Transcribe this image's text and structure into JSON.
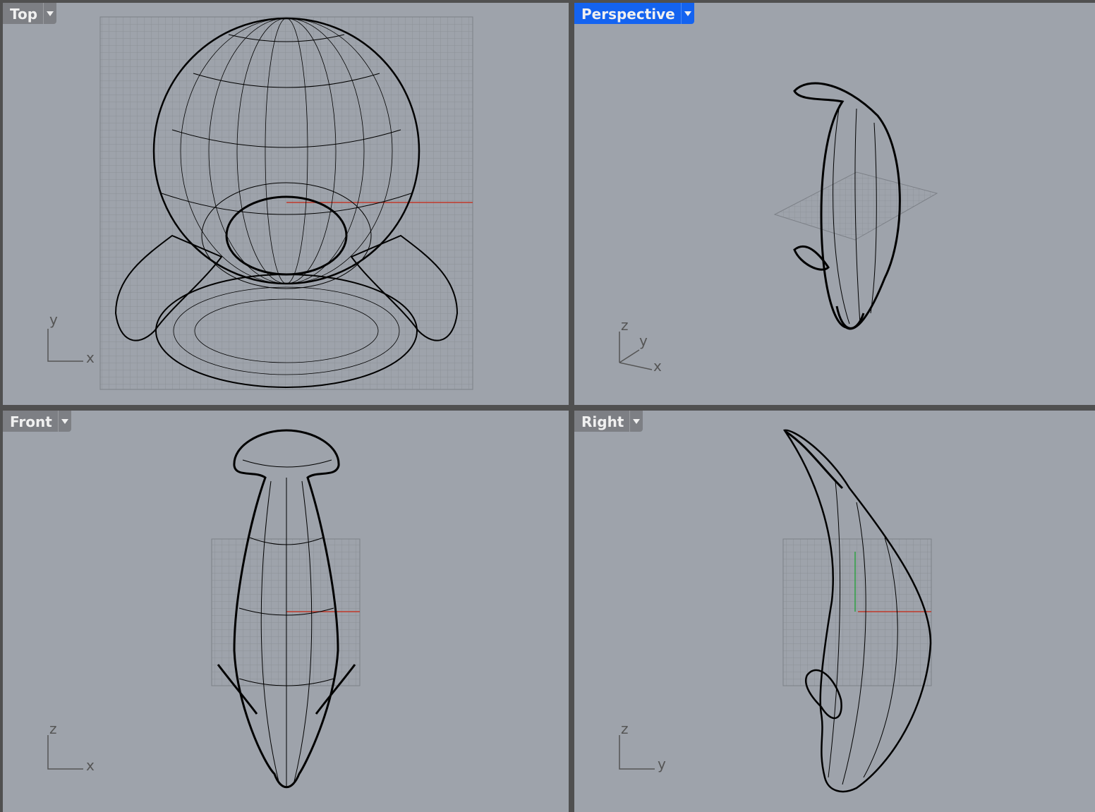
{
  "viewports": {
    "top": {
      "title": "Top",
      "axis_h": "x",
      "axis_v": "y"
    },
    "perspective": {
      "title": "Perspective",
      "axis_x": "x",
      "axis_y": "y",
      "axis_z": "z"
    },
    "front": {
      "title": "Front",
      "axis_h": "x",
      "axis_v": "z"
    },
    "right": {
      "title": "Right",
      "axis_h": "y",
      "axis_v": "z"
    }
  },
  "icons": {
    "dropdown": "chevron-down-icon"
  },
  "colors": {
    "viewport_bg": "#9ea3ab",
    "active_tab": "#1463f0",
    "x_axis": "#c0392b",
    "y_axis": "#2ea043",
    "wire": "#000000"
  }
}
